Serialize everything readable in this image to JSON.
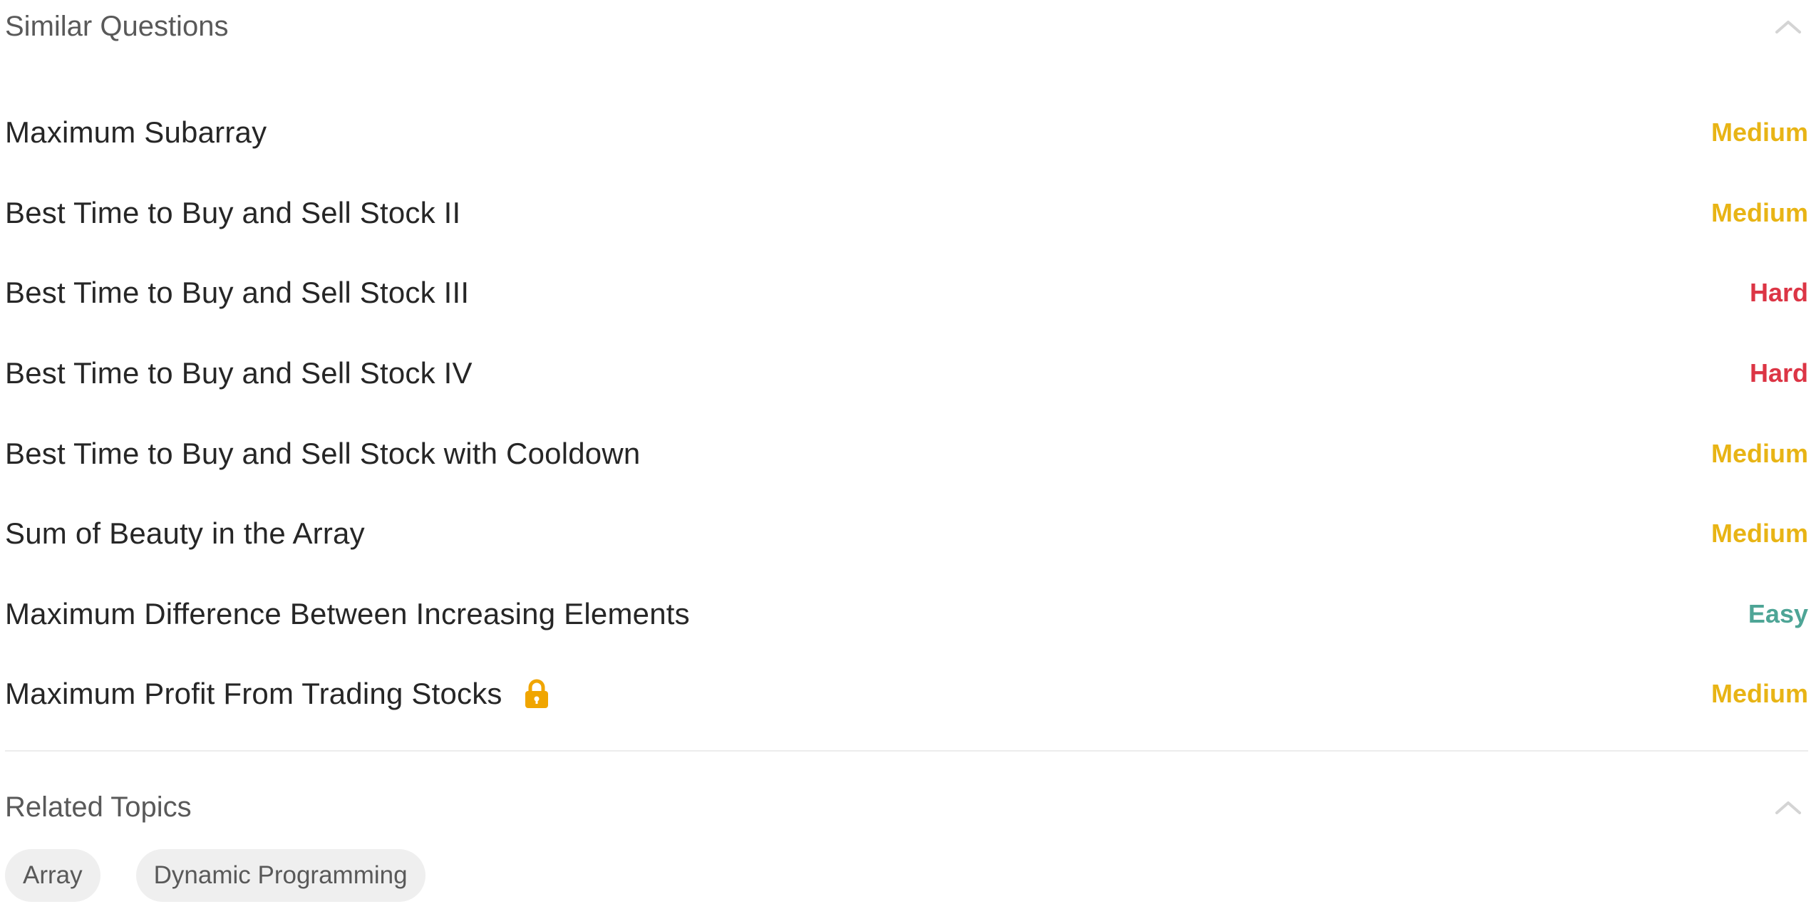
{
  "similar_questions": {
    "title": "Similar Questions",
    "toggle_icon": "chevron-up-icon",
    "items": [
      {
        "title": "Maximum Subarray",
        "difficulty": "Medium",
        "color": "#e8b415",
        "locked": false
      },
      {
        "title": "Best Time to Buy and Sell Stock II",
        "difficulty": "Medium",
        "color": "#e8b415",
        "locked": false
      },
      {
        "title": "Best Time to Buy and Sell Stock III",
        "difficulty": "Hard",
        "color": "#dc3545",
        "locked": false
      },
      {
        "title": "Best Time to Buy and Sell Stock IV",
        "difficulty": "Hard",
        "color": "#dc3545",
        "locked": false
      },
      {
        "title": "Best Time to Buy and Sell Stock with Cooldown",
        "difficulty": "Medium",
        "color": "#e8b415",
        "locked": false
      },
      {
        "title": "Sum of Beauty in the Array",
        "difficulty": "Medium",
        "color": "#e8b415",
        "locked": false
      },
      {
        "title": "Maximum Difference Between Increasing Elements",
        "difficulty": "Easy",
        "color": "#4ea596",
        "locked": false
      },
      {
        "title": "Maximum Profit From Trading Stocks",
        "difficulty": "Medium",
        "color": "#e8b415",
        "locked": true,
        "lock_icon": "lock-icon",
        "lock_color": "#f0a500"
      }
    ]
  },
  "related_topics": {
    "title": "Related Topics",
    "toggle_icon": "chevron-up-icon",
    "tags": [
      "Array",
      "Dynamic Programming"
    ]
  }
}
